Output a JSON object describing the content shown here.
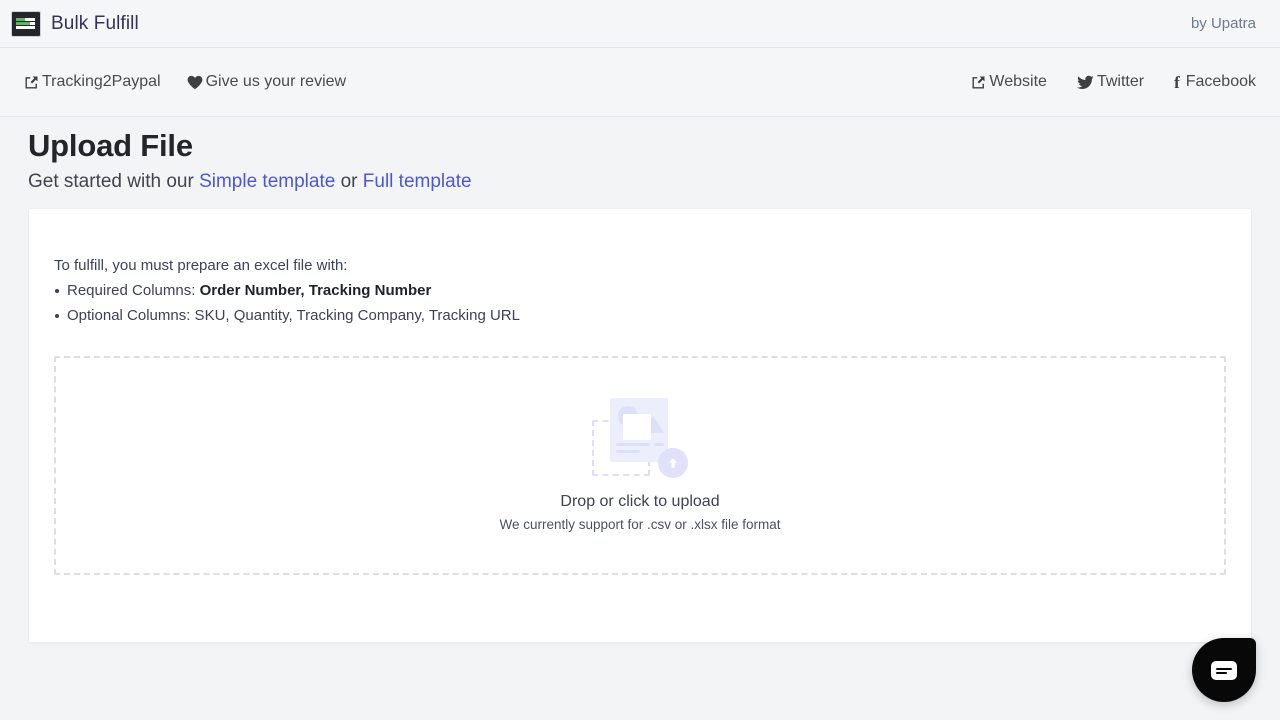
{
  "brandbar": {
    "logo_icon": "bulk-fulfill-logo",
    "app_title": "Bulk Fulfill",
    "attribution": "by Upatra"
  },
  "navbar": {
    "left_links": [
      {
        "icon": "external-link-icon",
        "label": "Tracking2Paypal"
      },
      {
        "icon": "heart-icon",
        "label": "Give us your review"
      }
    ],
    "right_links": [
      {
        "icon": "external-link-icon",
        "label": "Website"
      },
      {
        "icon": "twitter-icon",
        "label": "Twitter"
      },
      {
        "icon": "facebook-icon",
        "label": "Facebook"
      }
    ]
  },
  "page": {
    "title": "Upload File",
    "subtitle_prefix": "Get started with our ",
    "link_simple": "Simple template",
    "subtitle_middle": " or ",
    "link_full": "Full template"
  },
  "card": {
    "lead": "To fulfill, you must prepare an excel file with:",
    "required_label": "Required Columns: ",
    "required_columns": "Order Number, Tracking Number",
    "optional_line": "Optional Columns: SKU, Quantity, Tracking Company, Tracking URL"
  },
  "dropzone": {
    "illustration_icon": "file-upload-illustration",
    "title": "Drop or click to upload",
    "subtitle": "We currently support for .csv or .xlsx file format"
  },
  "chat": {
    "icon": "chat-bubble-icon"
  },
  "colors": {
    "page_background": "#f3f4f6",
    "card_background": "#ffffff",
    "link_blue": "#4c57d4",
    "title_dark": "#22252a",
    "body_text": "#3c4257",
    "dashed_border": "#dcdee1",
    "illustration_lavender": "#dde1f7",
    "chat_black": "#080808",
    "logo_green": "#5cb85c"
  }
}
